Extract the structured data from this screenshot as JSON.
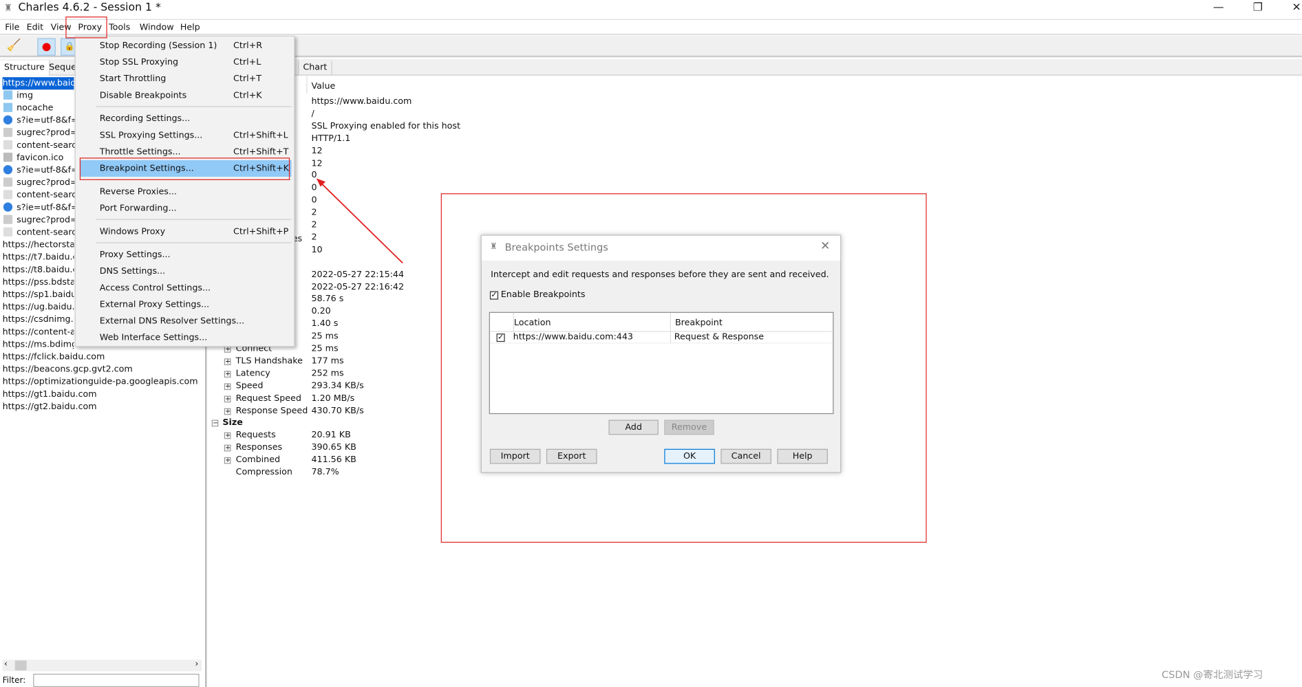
{
  "window": {
    "title": "Charles 4.6.2 - Session 1 *",
    "minimize": "—",
    "restore": "❐",
    "close": "✕"
  },
  "menubar": [
    "File",
    "Edit",
    "View",
    "Proxy",
    "Tools",
    "Window",
    "Help"
  ],
  "toolbar": {
    "icons": [
      "broom-icon",
      "record-icon",
      "ssl-lock-icon"
    ]
  },
  "left_panel": {
    "tabs": [
      "Structure",
      "Seque"
    ],
    "tree": [
      {
        "label": "https://www.baidu",
        "icon": "globe",
        "selected": true
      },
      {
        "label": "img",
        "icon": "folder"
      },
      {
        "label": "nocache",
        "icon": "folder"
      },
      {
        "label": "s?ie=utf-8&f=8",
        "icon": "blue-dot"
      },
      {
        "label": "sugrec?prod=",
        "icon": "doc"
      },
      {
        "label": "content-search",
        "icon": "code"
      },
      {
        "label": "favicon.ico",
        "icon": "image"
      },
      {
        "label": "s?ie=utf-8&f=8",
        "icon": "blue-dot"
      },
      {
        "label": "sugrec?prod=",
        "icon": "doc"
      },
      {
        "label": "content-search",
        "icon": "code"
      },
      {
        "label": "s?ie=utf-8&f=8",
        "icon": "blue-dot"
      },
      {
        "label": "sugrec?prod=",
        "icon": "doc"
      },
      {
        "label": "content-search",
        "icon": "code"
      },
      {
        "label": "https://hectorstati"
      },
      {
        "label": "https://t7.baidu.co"
      },
      {
        "label": "https://t8.baidu.co"
      },
      {
        "label": "https://pss.bdstat"
      },
      {
        "label": "https://sp1.baidu."
      },
      {
        "label": "https://ug.baidu.c"
      },
      {
        "label": "https://csdnimg.cr"
      },
      {
        "label": "https://content-au"
      },
      {
        "label": "https://ms.bdimg."
      },
      {
        "label": "https://fclick.baidu.com"
      },
      {
        "label": "https://beacons.gcp.gvt2.com"
      },
      {
        "label": "https://optimizationguide-pa.googleapis.com"
      },
      {
        "label": "https://gt1.baidu.com"
      },
      {
        "label": "https://gt2.baidu.com"
      }
    ],
    "filter_label": "Filter:",
    "filter_value": ""
  },
  "right_panel": {
    "tab": "Chart",
    "value_header": "Value",
    "partial_label": "es",
    "values": [
      "https://www.baidu.com",
      "/",
      "SSL Proxying enabled for this host",
      "HTTP/1.1",
      "12",
      "12",
      "0",
      "0",
      "0",
      "2",
      "2",
      "2",
      "10",
      "",
      "2022-05-27 22:15:44",
      "2022-05-27 22:16:42",
      "58.76 s",
      "0.20",
      "1.40 s",
      "25 ms",
      "25 ms",
      "177 ms",
      "252 ms",
      "293.34 KB/s",
      "1.20 MB/s",
      "430.70 KB/s",
      "",
      "20.91 KB",
      "390.65 KB",
      "411.56 KB",
      "78.7%"
    ],
    "labels": [
      {
        "row": 20,
        "label": "Connect",
        "expander": "+"
      },
      {
        "row": 21,
        "label": "TLS Handshake",
        "expander": "+"
      },
      {
        "row": 22,
        "label": "Latency",
        "expander": "+"
      },
      {
        "row": 23,
        "label": "Speed",
        "expander": "+"
      },
      {
        "row": 24,
        "label": "Request Speed",
        "expander": "+"
      },
      {
        "row": 25,
        "label": "Response Speed",
        "expander": "+"
      },
      {
        "row": 26,
        "label": "Size",
        "expander": "−",
        "section": true
      },
      {
        "row": 27,
        "label": "Requests",
        "expander": "+"
      },
      {
        "row": 28,
        "label": "Responses",
        "expander": "+"
      },
      {
        "row": 29,
        "label": "Combined",
        "expander": "+"
      },
      {
        "row": 30,
        "label": "Compression",
        "expander": ""
      }
    ]
  },
  "proxy_menu": [
    {
      "label": "Stop Recording (Session 1)",
      "shortcut": "Ctrl+R"
    },
    {
      "label": "Stop SSL Proxying",
      "shortcut": "Ctrl+L"
    },
    {
      "label": "Start Throttling",
      "shortcut": "Ctrl+T"
    },
    {
      "label": "Disable Breakpoints",
      "shortcut": "Ctrl+K"
    },
    {
      "sep": true
    },
    {
      "label": "Recording Settings...",
      "shortcut": ""
    },
    {
      "label": "SSL Proxying Settings...",
      "shortcut": "Ctrl+Shift+L"
    },
    {
      "label": "Throttle Settings...",
      "shortcut": "Ctrl+Shift+T"
    },
    {
      "label": "Breakpoint Settings...",
      "shortcut": "Ctrl+Shift+K",
      "highlighted": true
    },
    {
      "sep": true
    },
    {
      "label": "Reverse Proxies...",
      "shortcut": ""
    },
    {
      "label": "Port Forwarding...",
      "shortcut": ""
    },
    {
      "sep": true
    },
    {
      "label": "Windows Proxy",
      "shortcut": "Ctrl+Shift+P"
    },
    {
      "sep": true
    },
    {
      "label": "Proxy Settings...",
      "shortcut": ""
    },
    {
      "label": "DNS Settings...",
      "shortcut": ""
    },
    {
      "label": "Access Control Settings...",
      "shortcut": ""
    },
    {
      "label": "External Proxy Settings...",
      "shortcut": ""
    },
    {
      "label": "External DNS Resolver Settings...",
      "shortcut": ""
    },
    {
      "label": "Web Interface Settings...",
      "shortcut": ""
    }
  ],
  "dialog": {
    "title": "Breakpoints Settings",
    "description": "Intercept and edit requests and responses before they are sent and received.",
    "enable_label": "Enable Breakpoints",
    "enabled": true,
    "columns": [
      "Location",
      "Breakpoint"
    ],
    "rows": [
      {
        "checked": true,
        "location": "https://www.baidu.com:443",
        "breakpoint": "Request & Response"
      }
    ],
    "buttons": {
      "add": "Add",
      "remove": "Remove",
      "import": "Import",
      "export": "Export",
      "ok": "OK",
      "cancel": "Cancel",
      "help": "Help"
    }
  },
  "annotation_color": "#e02020",
  "watermark": "CSDN @寄北测试学习"
}
